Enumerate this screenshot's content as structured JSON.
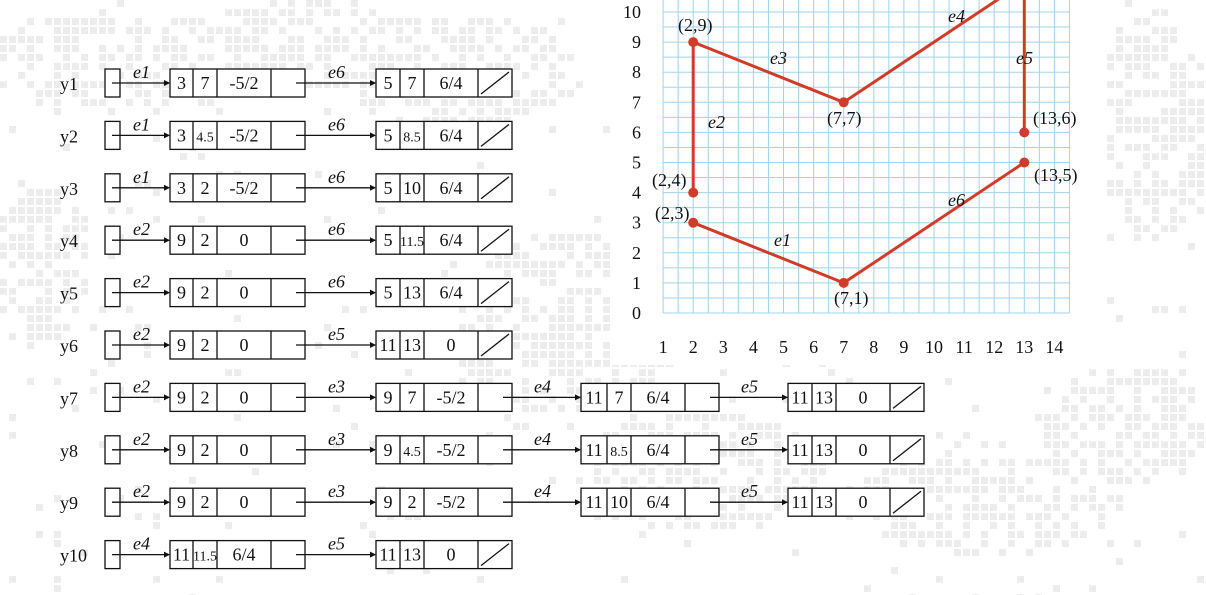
{
  "colors": {
    "grid": "#9fd3ee",
    "polygon": "#d03c28",
    "box": "#111111",
    "text": "#111111",
    "panel": "#ffffff",
    "background": "#ececec"
  },
  "graph": {
    "x_ticks": [
      "1",
      "2",
      "3",
      "4",
      "5",
      "6",
      "7",
      "8",
      "9",
      "10",
      "11",
      "12",
      "13",
      "14"
    ],
    "y_ticks": [
      "0",
      "1",
      "2",
      "3",
      "4",
      "5",
      "6",
      "7",
      "8",
      "9",
      "10"
    ],
    "vertices": [
      {
        "x": 7,
        "y": 1,
        "label": "(7,1)"
      },
      {
        "x": 2,
        "y": 3,
        "label": "(2,3)"
      },
      {
        "x": 2,
        "y": 4,
        "label": "(2,4)"
      },
      {
        "x": 2,
        "y": 9,
        "label": "(2,9)"
      },
      {
        "x": 7,
        "y": 7,
        "label": "(7,7)"
      },
      {
        "x": 13,
        "y": 6,
        "label": "(13,6)"
      },
      {
        "x": 13,
        "y": 5,
        "label": "(13,5)"
      }
    ],
    "edges": [
      {
        "name": "e1",
        "from": [
          7,
          1
        ],
        "to": [
          2,
          3
        ]
      },
      {
        "name": "e2",
        "from": [
          2,
          4
        ],
        "to": [
          2,
          9
        ]
      },
      {
        "name": "e3",
        "from": [
          2,
          9
        ],
        "to": [
          7,
          7
        ]
      },
      {
        "name": "e4",
        "from": [
          7,
          7
        ],
        "to": [
          13,
          11
        ]
      },
      {
        "name": "e5",
        "from": [
          13,
          11
        ],
        "to": [
          13,
          6
        ]
      },
      {
        "name": "e6",
        "from": [
          13,
          5
        ],
        "to": [
          7,
          1
        ]
      }
    ]
  },
  "rows": [
    {
      "label": "y1",
      "nodes": [
        {
          "edge": "e1",
          "cells": [
            "3",
            "7",
            "-5/2"
          ]
        },
        {
          "edge": "e6",
          "cells": [
            "5",
            "7",
            "6/4"
          ]
        }
      ]
    },
    {
      "label": "y2",
      "nodes": [
        {
          "edge": "e1",
          "cells": [
            "3",
            "4.5",
            "-5/2"
          ]
        },
        {
          "edge": "e6",
          "cells": [
            "5",
            "8.5",
            "6/4"
          ]
        }
      ]
    },
    {
      "label": "y3",
      "nodes": [
        {
          "edge": "e1",
          "cells": [
            "3",
            "2",
            "-5/2"
          ]
        },
        {
          "edge": "e6",
          "cells": [
            "5",
            "10",
            "6/4"
          ]
        }
      ]
    },
    {
      "label": "y4",
      "nodes": [
        {
          "edge": "e2",
          "cells": [
            "9",
            "2",
            "0"
          ]
        },
        {
          "edge": "e6",
          "cells": [
            "5",
            "11.5",
            "6/4"
          ]
        }
      ]
    },
    {
      "label": "y5",
      "nodes": [
        {
          "edge": "e2",
          "cells": [
            "9",
            "2",
            "0"
          ]
        },
        {
          "edge": "e6",
          "cells": [
            "5",
            "13",
            "6/4"
          ]
        }
      ]
    },
    {
      "label": "y6",
      "nodes": [
        {
          "edge": "e2",
          "cells": [
            "9",
            "2",
            "0"
          ]
        },
        {
          "edge": "e5",
          "cells": [
            "11",
            "13",
            "0"
          ]
        }
      ]
    },
    {
      "label": "y7",
      "nodes": [
        {
          "edge": "e2",
          "cells": [
            "9",
            "2",
            "0"
          ]
        },
        {
          "edge": "e3",
          "cells": [
            "9",
            "7",
            "-5/2"
          ]
        },
        {
          "edge": "e4",
          "cells": [
            "11",
            "7",
            "6/4"
          ]
        },
        {
          "edge": "e5",
          "cells": [
            "11",
            "13",
            "0"
          ]
        }
      ]
    },
    {
      "label": "y8",
      "nodes": [
        {
          "edge": "e2",
          "cells": [
            "9",
            "2",
            "0"
          ]
        },
        {
          "edge": "e3",
          "cells": [
            "9",
            "4.5",
            "-5/2"
          ]
        },
        {
          "edge": "e4",
          "cells": [
            "11",
            "8.5",
            "6/4"
          ]
        },
        {
          "edge": "e5",
          "cells": [
            "11",
            "13",
            "0"
          ]
        }
      ]
    },
    {
      "label": "y9",
      "nodes": [
        {
          "edge": "e2",
          "cells": [
            "9",
            "2",
            "0"
          ]
        },
        {
          "edge": "e3",
          "cells": [
            "9",
            "2",
            "-5/2"
          ]
        },
        {
          "edge": "e4",
          "cells": [
            "11",
            "10",
            "6/4"
          ]
        },
        {
          "edge": "e5",
          "cells": [
            "11",
            "13",
            "0"
          ]
        }
      ]
    },
    {
      "label": "y10",
      "nodes": [
        {
          "edge": "e4",
          "cells": [
            "11",
            "11.5",
            "6/4"
          ]
        },
        {
          "edge": "e5",
          "cells": [
            "11",
            "13",
            "0"
          ]
        }
      ]
    }
  ]
}
